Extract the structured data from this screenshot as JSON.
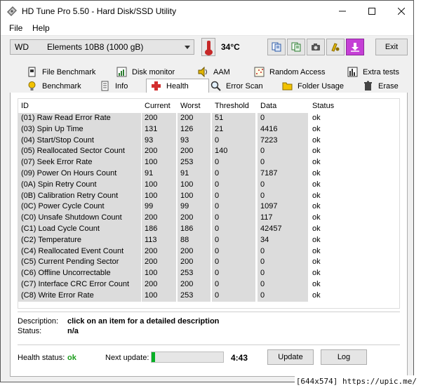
{
  "window": {
    "title": "HD Tune Pro 5.50 - Hard Disk/SSD Utility"
  },
  "menu": {
    "items": [
      "File",
      "Help"
    ]
  },
  "toolbar": {
    "drive_brand": "WD",
    "drive_model": "Elements 10B8 (1000 gB)",
    "temperature": "34°C",
    "exit_label": "Exit",
    "icons": [
      "copy-text-icon",
      "copy-info-icon",
      "screenshot-camera-icon",
      "options-icon",
      "save-download-icon"
    ]
  },
  "tabs": {
    "row1": [
      "File Benchmark",
      "Disk monitor",
      "AAM",
      "Random Access",
      "Extra tests"
    ],
    "row2": [
      "Benchmark",
      "Info",
      "Health",
      "Error Scan",
      "Folder Usage",
      "Erase"
    ],
    "active": "Health"
  },
  "table": {
    "headers": [
      "ID",
      "Current",
      "Worst",
      "Threshold",
      "Data",
      "Status"
    ],
    "rows": [
      [
        "(01) Raw Read Error Rate",
        "200",
        "200",
        "51",
        "0",
        "ok"
      ],
      [
        "(03) Spin Up Time",
        "131",
        "126",
        "21",
        "4416",
        "ok"
      ],
      [
        "(04) Start/Stop Count",
        "93",
        "93",
        "0",
        "7223",
        "ok"
      ],
      [
        "(05) Reallocated Sector Count",
        "200",
        "200",
        "140",
        "0",
        "ok"
      ],
      [
        "(07) Seek Error Rate",
        "100",
        "253",
        "0",
        "0",
        "ok"
      ],
      [
        "(09) Power On Hours Count",
        "91",
        "91",
        "0",
        "7187",
        "ok"
      ],
      [
        "(0A) Spin Retry Count",
        "100",
        "100",
        "0",
        "0",
        "ok"
      ],
      [
        "(0B) Calibration Retry Count",
        "100",
        "100",
        "0",
        "0",
        "ok"
      ],
      [
        "(0C) Power Cycle Count",
        "99",
        "99",
        "0",
        "1097",
        "ok"
      ],
      [
        "(C0) Unsafe Shutdown Count",
        "200",
        "200",
        "0",
        "117",
        "ok"
      ],
      [
        "(C1) Load Cycle Count",
        "186",
        "186",
        "0",
        "42457",
        "ok"
      ],
      [
        "(C2) Temperature",
        "113",
        "88",
        "0",
        "34",
        "ok"
      ],
      [
        "(C4) Reallocated Event Count",
        "200",
        "200",
        "0",
        "0",
        "ok"
      ],
      [
        "(C5) Current Pending Sector",
        "200",
        "200",
        "0",
        "0",
        "ok"
      ],
      [
        "(C6) Offline Uncorrectable",
        "100",
        "253",
        "0",
        "0",
        "ok"
      ],
      [
        "(C7) Interface CRC Error Count",
        "200",
        "200",
        "0",
        "0",
        "ok"
      ],
      [
        "(C8) Write Error Rate",
        "100",
        "253",
        "0",
        "0",
        "ok"
      ]
    ]
  },
  "description": {
    "label": "Description:",
    "value": "click on an item for a detailed description",
    "status_label": "Status:",
    "status_value": "n/a"
  },
  "footer": {
    "health_label": "Health status:",
    "health_value": "ok",
    "next_update_label": "Next update:",
    "progress_fraction": 0.05,
    "countdown": "4:43",
    "update_button": "Update",
    "log_button": "Log"
  },
  "watermark": "[644x574] https://upic.me/",
  "colors": {
    "ok_green": "#1a9c1a",
    "progress_green": "#06b025",
    "cell_gray": "#dcdcdc"
  }
}
